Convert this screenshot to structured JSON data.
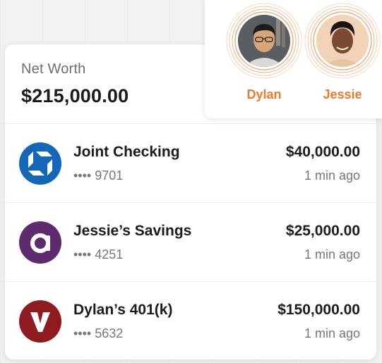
{
  "net_worth": {
    "label": "Net Worth",
    "value": "$215,000.00"
  },
  "accounts": [
    {
      "name": "Joint Checking",
      "mask": "•••• 9701",
      "last4": "9701",
      "amount": "$40,000.00",
      "updated": "1 min ago",
      "logo": "chase-octagon-icon",
      "color": "#1466b8"
    },
    {
      "name": "Jessie’s Savings",
      "mask": "•••• 4251",
      "last4": "4251",
      "amount": "$25,000.00",
      "updated": "1 min ago",
      "logo": "ally-a-icon",
      "color": "#5e2b6e"
    },
    {
      "name": "Dylan’s 401(k)",
      "mask": "•••• 5632",
      "last4": "5632",
      "amount": "$150,000.00",
      "updated": "1 min ago",
      "logo": "vanguard-v-icon",
      "color": "#8f1a1f"
    }
  ],
  "users": [
    {
      "name": "Dylan",
      "avatar": "dylan-avatar"
    },
    {
      "name": "Jessie",
      "avatar": "jessie-avatar"
    }
  ],
  "colors": {
    "accent": "#ef7a2b",
    "ring": "#f6c8a6"
  }
}
